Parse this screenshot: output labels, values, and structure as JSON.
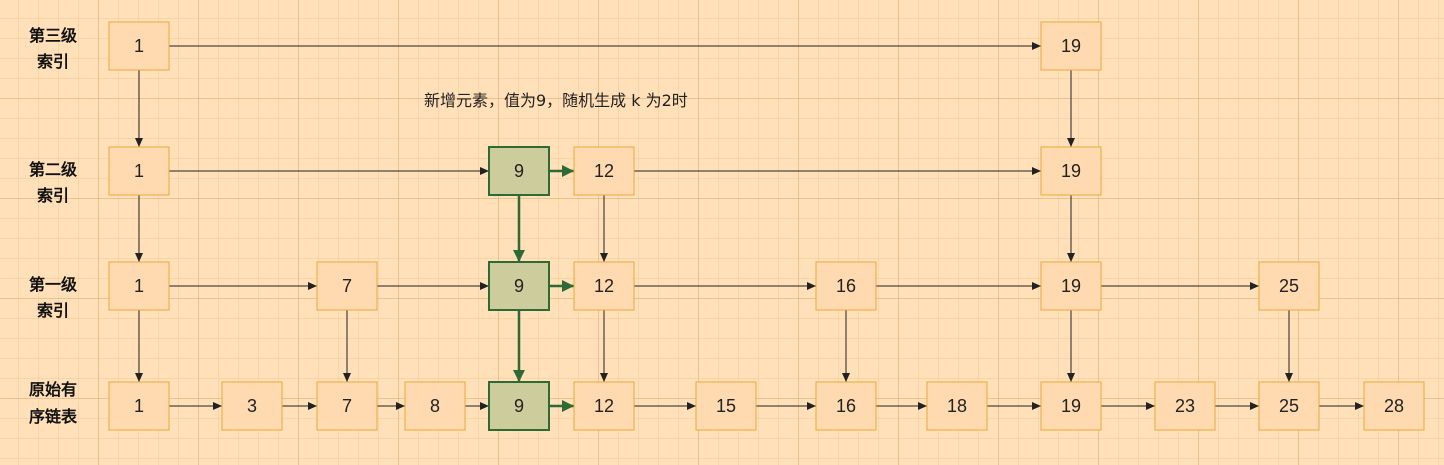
{
  "caption": "新增元素，值为9，随机生成 k 为2时",
  "levels": [
    {
      "id": "l3",
      "label_lines": [
        "第三级",
        "索引"
      ],
      "nodes": [
        "1",
        "19"
      ]
    },
    {
      "id": "l2",
      "label_lines": [
        "第二级",
        "索引"
      ],
      "nodes": [
        "1",
        "9",
        "12",
        "19"
      ]
    },
    {
      "id": "l1",
      "label_lines": [
        "第一级",
        "索引"
      ],
      "nodes": [
        "1",
        "7",
        "9",
        "12",
        "16",
        "19",
        "25"
      ]
    },
    {
      "id": "l0",
      "label_lines": [
        "原始有",
        "序链表"
      ],
      "nodes": [
        "1",
        "3",
        "7",
        "8",
        "9",
        "12",
        "15",
        "16",
        "18",
        "19",
        "23",
        "25",
        "28"
      ]
    }
  ],
  "new_value": "9",
  "colors": {
    "background": "#ffe0b8",
    "node_fill": "#ffdab0",
    "node_border": "#e8a93a",
    "new_node_fill": "#cdcc9c",
    "new_node_border": "#2e6b34",
    "arrow": "#222222",
    "new_arrow": "#2e6b34"
  }
}
